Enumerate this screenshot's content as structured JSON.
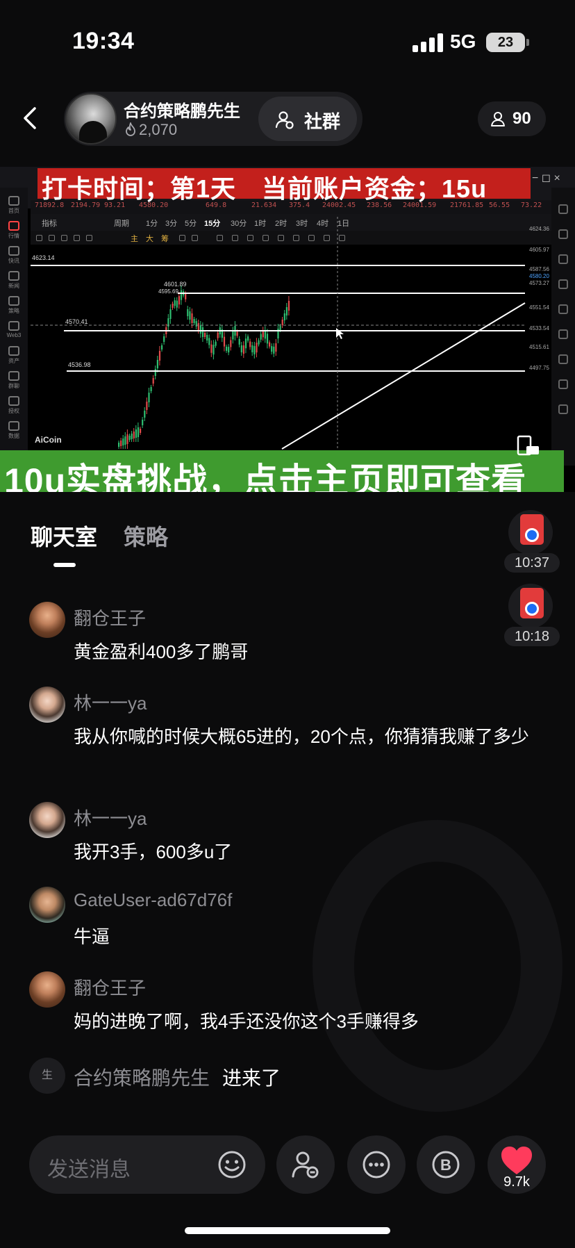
{
  "status_bar": {
    "time": "19:34",
    "network": "5G",
    "battery": "23"
  },
  "header": {
    "host_name": "合约策略鹏先生",
    "host_likes": "2,070",
    "community_label": "社群",
    "viewer_count": "90"
  },
  "video": {
    "top_banner": "打卡时间；第1天　当前账户资金；15u",
    "bottom_banner": "10u实盘挑战，点击主页即可查看",
    "watermark": "AiCoin",
    "window_controls": "− ◻ ×",
    "chart_levels": {
      "top_left": "4623.14",
      "peak": "4601.89",
      "peak_alt": "4595.69",
      "mid": "4570.41",
      "low": "4536.98"
    },
    "axis_prices": [
      "4624.36",
      "4605.97",
      "4587.56",
      "4580.20",
      "4573.27",
      "4551.54",
      "4533.54",
      "4515.61",
      "4497.75"
    ],
    "ticker_values": [
      "71892.8",
      "2194.79",
      "93.21",
      "4580.20",
      "649.8",
      "21.634",
      "375.4",
      "24002.45",
      "238.56",
      "24001.59",
      "21761.85",
      "56.55",
      "73.22"
    ],
    "timeframes": [
      "指标",
      "周期",
      "1分",
      "3分",
      "5分",
      "15分",
      "30分",
      "1时",
      "2时",
      "3时",
      "4时",
      "1日"
    ],
    "drawing_tools": [
      "主",
      "大",
      "筹"
    ],
    "sidebar_labels": [
      "首页",
      "行情",
      "快讯",
      "新闻",
      "策略",
      "Web3",
      "资产",
      "群聊",
      "授权",
      "数据"
    ]
  },
  "tabs": [
    {
      "label": "聊天室",
      "active": true
    },
    {
      "label": "策略",
      "active": false
    }
  ],
  "gifts": [
    {
      "time": "10:37"
    },
    {
      "time": "10:18"
    }
  ],
  "messages": [
    {
      "user": "翻仓王子",
      "text": "黄金盈利400多了鹏哥"
    },
    {
      "user": "林一一ya",
      "text": "我从你喊的时候大概65进的，20个点，你猜猜我赚了多少"
    },
    {
      "user": "林一一ya",
      "text": "我开3手，600多u了"
    },
    {
      "user": "GateUser-ad67d76f",
      "text": "牛逼"
    },
    {
      "user": "翻仓王子",
      "text": "妈的进晚了啊，我4手还没你这个3手赚得多"
    }
  ],
  "system_message": {
    "avatar_text": "生",
    "user": "合约策略鹏先生",
    "text": "进来了"
  },
  "bottom_bar": {
    "input_placeholder": "发送消息",
    "like_count": "9.7k"
  },
  "colors": {
    "background": "#0b0b0c",
    "banner_red": "#c3201c",
    "banner_green": "#3f9b2f",
    "heart": "#ff3b5c"
  }
}
